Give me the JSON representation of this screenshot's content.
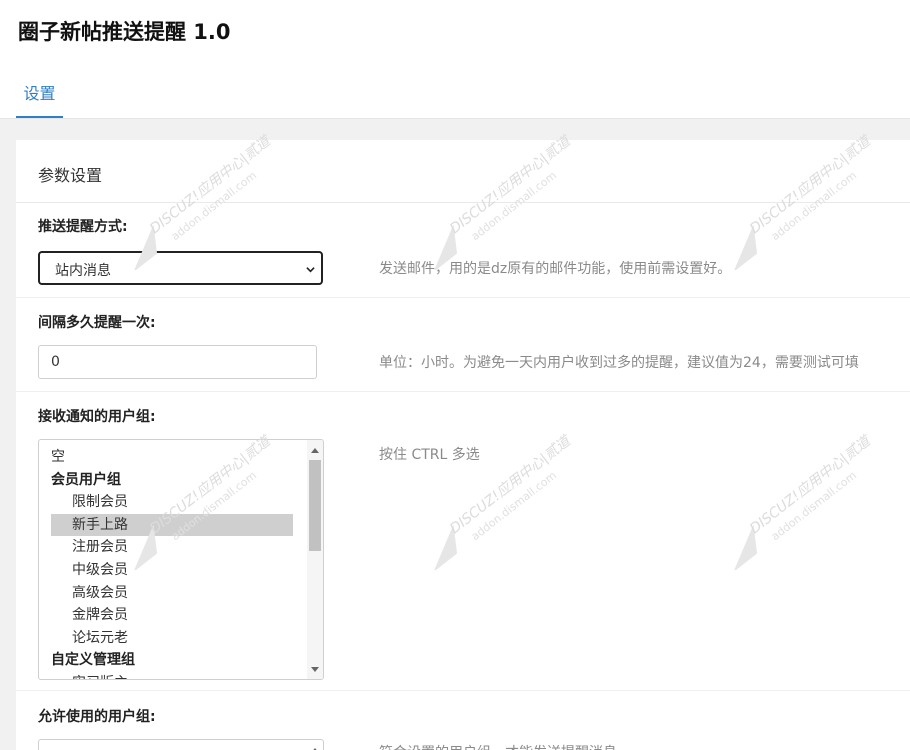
{
  "app": {
    "title": "圈子新帖推送提醒 1.0"
  },
  "tabs": [
    {
      "label": "设置"
    }
  ],
  "panel": {
    "title": "参数设置"
  },
  "fields": {
    "push_method": {
      "label": "推送提醒方式:",
      "value": "站内消息",
      "help": "发送邮件，用的是dz原有的邮件功能，使用前需设置好。"
    },
    "interval": {
      "label": "间隔多久提醒一次:",
      "value": "0",
      "help": "单位：小时。为避免一天内用户收到过多的提醒，建议值为24，需要测试可填"
    },
    "receive_groups": {
      "label": "接收通知的用户组:",
      "help": "按住 CTRL 多选",
      "options": [
        {
          "label": "空",
          "kind": "plain"
        },
        {
          "label": "会员用户组",
          "kind": "group"
        },
        {
          "label": "限制会员",
          "kind": "indent"
        },
        {
          "label": "新手上路",
          "kind": "indent",
          "selected": true
        },
        {
          "label": "注册会员",
          "kind": "indent"
        },
        {
          "label": "中级会员",
          "kind": "indent"
        },
        {
          "label": "高级会员",
          "kind": "indent"
        },
        {
          "label": "金牌会员",
          "kind": "indent"
        },
        {
          "label": "论坛元老",
          "kind": "indent"
        },
        {
          "label": "自定义管理组",
          "kind": "group"
        },
        {
          "label": "实习版主",
          "kind": "indent"
        }
      ]
    },
    "allowed_groups": {
      "label": "允许使用的用户组:",
      "help": "符合设置的用户组，才能发送提醒消息。"
    }
  },
  "watermark": {
    "line1": "DISCUZ!应用中心",
    "line2": "addon.dismall.com",
    "brand": "贰道"
  }
}
